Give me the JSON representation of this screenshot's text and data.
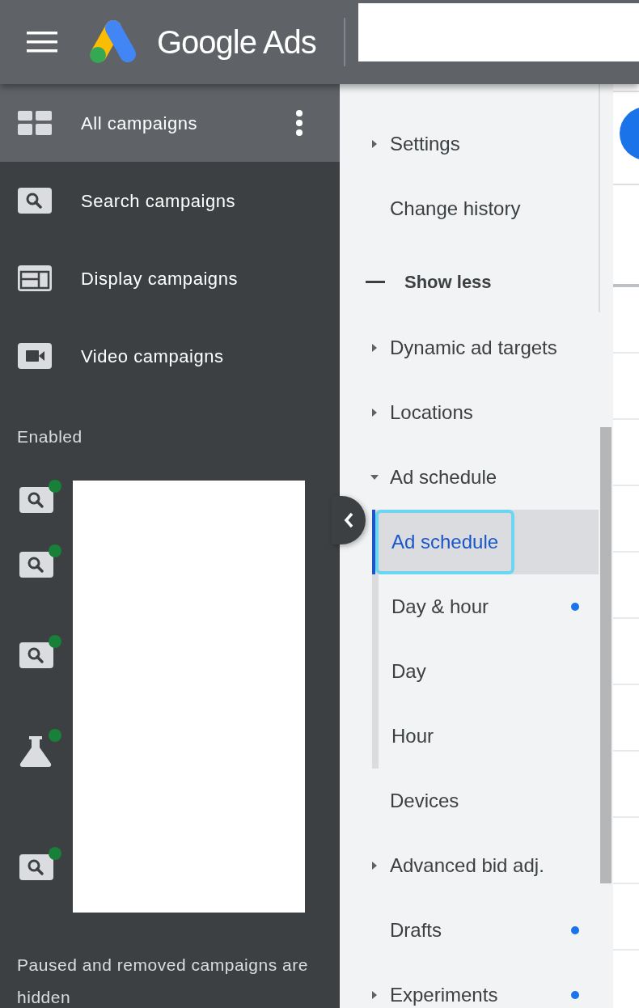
{
  "header": {
    "product_name": "Google Ads"
  },
  "sidebar": {
    "items": [
      {
        "label": "All campaigns",
        "kind": "grid",
        "selected": true
      },
      {
        "label": "Search campaigns",
        "kind": "search",
        "selected": false
      },
      {
        "label": "Display campaigns",
        "kind": "display",
        "selected": false
      },
      {
        "label": "Video campaigns",
        "kind": "video",
        "selected": false
      }
    ],
    "section_label": "Enabled",
    "campaigns": [
      {
        "kind": "search",
        "color": "#188038"
      },
      {
        "kind": "search",
        "color": "#188038"
      },
      {
        "kind": "search",
        "color": "#188038"
      },
      {
        "kind": "experiment",
        "color": "#188038"
      },
      {
        "kind": "search",
        "color": "#188038"
      }
    ],
    "footer_note": "Paused and removed campaigns are hidden"
  },
  "page_menu": {
    "items": [
      {
        "kind": "item",
        "label": "Settings",
        "expanded": false,
        "dot": false,
        "selected": false
      },
      {
        "kind": "item",
        "label": "Change history",
        "dot": false,
        "selected": false
      },
      {
        "kind": "divider"
      },
      {
        "kind": "toggle",
        "label": "Show less"
      },
      {
        "kind": "item",
        "label": "Dynamic ad targets",
        "expanded": false,
        "dot": false,
        "selected": false
      },
      {
        "kind": "item",
        "label": "Locations",
        "expanded": false,
        "dot": false,
        "selected": false
      },
      {
        "kind": "item",
        "label": "Ad schedule",
        "expanded": true,
        "dot": false,
        "selected": false,
        "children": [
          {
            "label": "Ad schedule",
            "dot": false,
            "selected": true
          },
          {
            "label": "Day & hour",
            "dot": true,
            "selected": false
          },
          {
            "label": "Day",
            "dot": false,
            "selected": false
          },
          {
            "label": "Hour",
            "dot": false,
            "selected": false
          }
        ]
      },
      {
        "kind": "item",
        "label": "Devices",
        "dot": false,
        "selected": false
      },
      {
        "kind": "item",
        "label": "Advanced bid adj.",
        "expanded": false,
        "dot": false,
        "selected": false
      },
      {
        "kind": "item",
        "label": "Drafts",
        "dot": true,
        "selected": false
      },
      {
        "kind": "item",
        "label": "Experiments",
        "expanded": false,
        "dot": true,
        "selected": false
      }
    ]
  }
}
